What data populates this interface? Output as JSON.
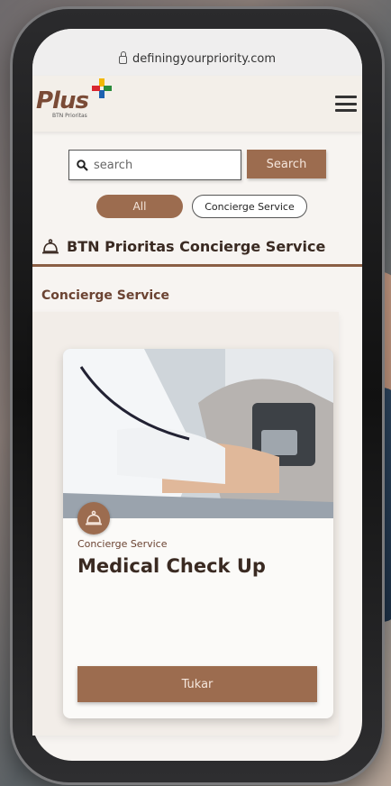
{
  "browser": {
    "url": "definingyourpriority.com"
  },
  "header": {
    "logo_text": "Plus",
    "logo_subtext": "BTN Prioritas"
  },
  "search": {
    "placeholder": "search",
    "button_label": "Search"
  },
  "filters": {
    "all_label": "All",
    "concierge_label": "Concierge Service"
  },
  "section": {
    "title": "BTN Prioritas Concierge Service"
  },
  "category": {
    "label": "Concierge Service"
  },
  "card": {
    "category": "Concierge Service",
    "title": "Medical Check Up",
    "button_label": "Tukar"
  },
  "colors": {
    "brand_brown": "#9c6c4f",
    "dark_text": "#3a2a22",
    "accent_brown": "#6b4332"
  },
  "icons": {
    "lock": "lock-icon",
    "menu": "hamburger-icon",
    "search": "search-icon",
    "service": "bell-icon"
  }
}
